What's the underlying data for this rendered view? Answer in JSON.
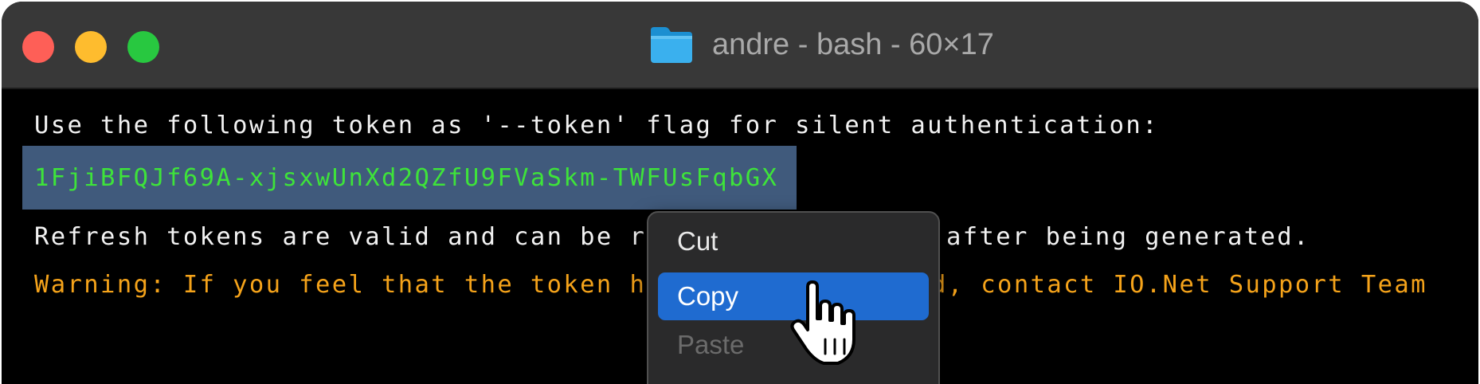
{
  "window": {
    "title": "andre - bash - 60×17",
    "folder_icon": "folder-icon"
  },
  "terminal": {
    "line1": "Use the following token as '--token' flag for silent authentication:",
    "token": "1FjiBFQJf69A-xjsxwUnXd2QZfU9FVaSkm-TWFUsFqbGX",
    "line3": "Refresh tokens are valid and can be re",
    "line3_tail": "after being generated.",
    "warning": "Warning: If you feel that the token ha",
    "warning_tail": "d, contact IO.Net Support Team",
    "colors": {
      "background": "#000000",
      "text": "#f2f2f2",
      "token": "#3ee33a",
      "warning": "#f5a31a",
      "selection": "#405a7c"
    }
  },
  "context_menu": {
    "items": [
      {
        "label": "Cut",
        "state": "normal"
      },
      {
        "label": "Copy",
        "state": "highlighted"
      },
      {
        "label": "Paste",
        "state": "disabled"
      }
    ],
    "highlight_color": "#1f6bd0"
  },
  "cursor": "pointing-hand-cursor-icon"
}
